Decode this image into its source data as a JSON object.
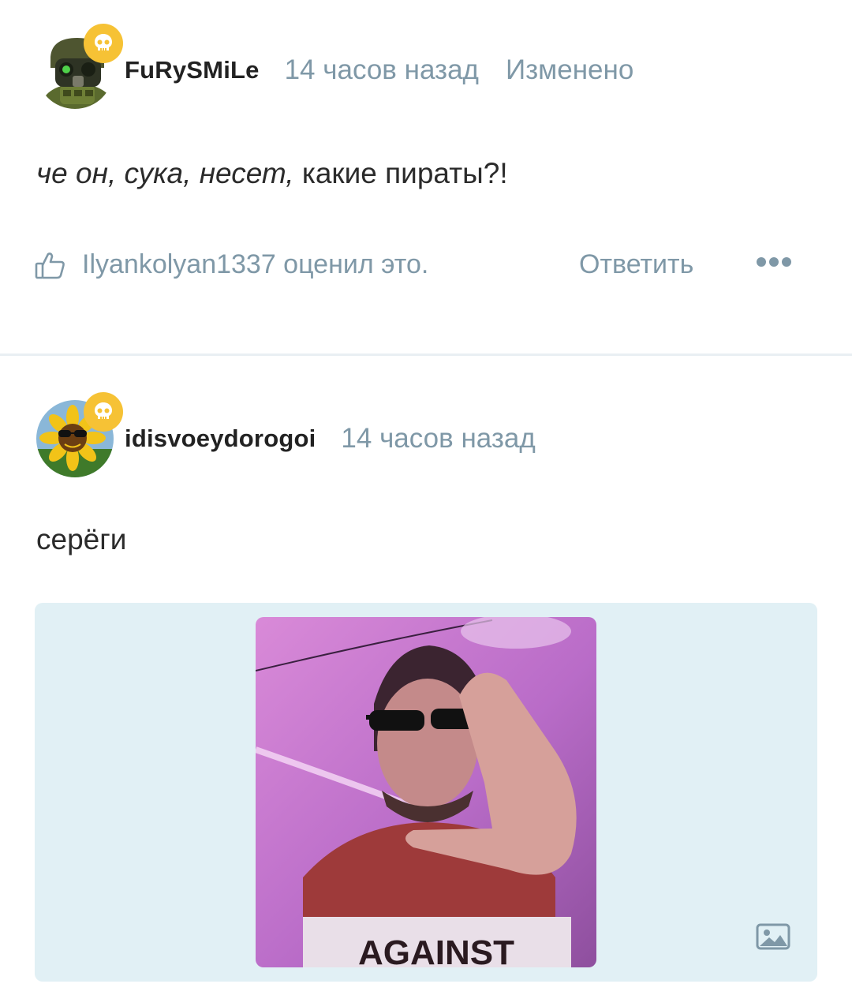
{
  "comments": [
    {
      "username": "FuRySMiLe",
      "time": "14 часов назад",
      "edited": "Изменено",
      "text_italic": "че он, сука, несет,",
      "text_normal": " какие пираты?!",
      "likes": "Ilyankolyan1337 оценил это.",
      "reply": "Ответить",
      "avatar_icon": "soldier-avatar",
      "badge_icon": "skull-icon"
    },
    {
      "username": "idisvoeydorogoi",
      "time": "14 часов назад",
      "text": "серёги",
      "avatar_icon": "sunflower-avatar",
      "badge_icon": "skull-icon",
      "attachment_icon": "image-icon"
    }
  ],
  "colors": {
    "meta": "#7f98a7",
    "badge": "#f6c235",
    "attachment_bg": "#e1f0f5",
    "divider": "#e9eff3"
  }
}
